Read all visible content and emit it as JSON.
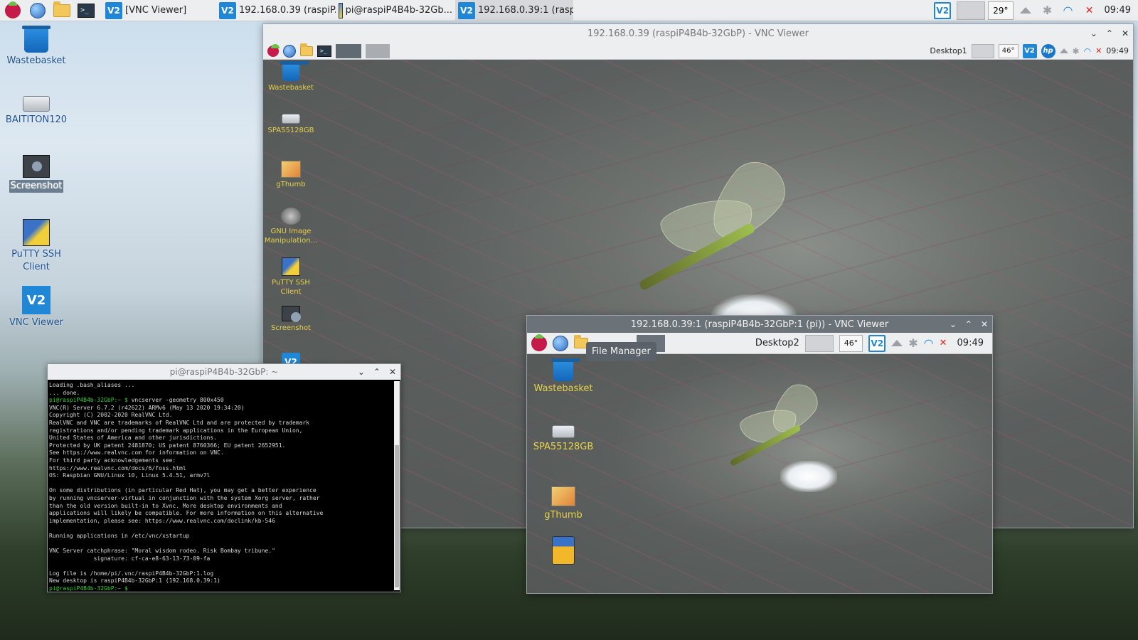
{
  "panel": {
    "tasks": [
      {
        "label": "[VNC Viewer]"
      },
      {
        "label": "192.168.0.39 (raspiP..."
      },
      {
        "label": "pi@raspiP4B4b-32Gb..."
      },
      {
        "label": "192.168.0.39:1 (raspi..."
      }
    ],
    "cpu_temp": "29°",
    "clock": "09:49"
  },
  "desktop_icons": [
    {
      "label": "Wastebasket"
    },
    {
      "label": "BAITITON120"
    },
    {
      "label": "Screenshot"
    },
    {
      "label": "PuTTY SSH Client"
    },
    {
      "label": "VNC Viewer"
    }
  ],
  "vnc1": {
    "title": "192.168.0.39 (raspiP4B4b-32GbP) - VNC Viewer",
    "panel": {
      "desktop_label": "Desktop1",
      "cpu_temp": "46°",
      "clock": "09:49"
    },
    "icons": [
      {
        "label": "Wastebasket"
      },
      {
        "label": "SPA55128GB"
      },
      {
        "label": "gThumb"
      },
      {
        "label": "GNU Image Manipulation..."
      },
      {
        "label": "PuTTY SSH Client"
      },
      {
        "label": "Screenshot"
      }
    ]
  },
  "terminal": {
    "title": "pi@raspiP4B4b-32GbP: ~",
    "lines": [
      "Loading .bash_aliases ...",
      "... done.",
      "pi@raspiP4B4b-32GbP:~ $ vncserver -geometry 800x450",
      "VNC(R) Server 6.7.2 (r42622) ARMv6 (May 13 2020 19:34:20)",
      "Copyright (C) 2002-2020 RealVNC Ltd.",
      "RealVNC and VNC are trademarks of RealVNC Ltd and are protected by trademark",
      "registrations and/or pending trademark applications in the European Union,",
      "United States of America and other jurisdictions.",
      "Protected by UK patent 2481870; US patent 8760366; EU patent 2652951.",
      "See https://www.realvnc.com for information on VNC.",
      "For third party acknowledgements see:",
      "https://www.realvnc.com/docs/6/foss.html",
      "OS: Raspbian GNU/Linux 10, Linux 5.4.51, armv7l",
      "",
      "On some distributions (in particular Red Hat), you may get a better experience",
      "by running vncserver-virtual in conjunction with the system Xorg server, rather",
      "than the old version built-in to Xvnc. More desktop environments and",
      "applications will likely be compatible. For more information on this alternative",
      "implementation, please see: https://www.realvnc.com/doclink/kb-546",
      "",
      "Running applications in /etc/vnc/xstartup",
      "",
      "VNC Server catchphrase: \"Moral wisdom rodeo. Risk Bombay tribune.\"",
      "             signature: cf-ca-e8-63-13-73-09-fa",
      "",
      "Log file is /home/pi/.vnc/raspiP4B4b-32GbP:1.log",
      "New desktop is raspiP4B4b-32GbP:1 (192.168.0.39:1)",
      "pi@raspiP4B4b-32GbP:~ $ "
    ]
  },
  "vnc2": {
    "title": "192.168.0.39:1 (raspiP4B4b-32GbP:1 (pi)) - VNC Viewer",
    "panel": {
      "desktop_label": "Desktop2",
      "cpu_temp": "46°",
      "clock": "09:49"
    },
    "tooltip": "File Manager",
    "icons": [
      {
        "label": "Wastebasket"
      },
      {
        "label": "SPA55128GB"
      },
      {
        "label": "gThumb"
      }
    ]
  }
}
